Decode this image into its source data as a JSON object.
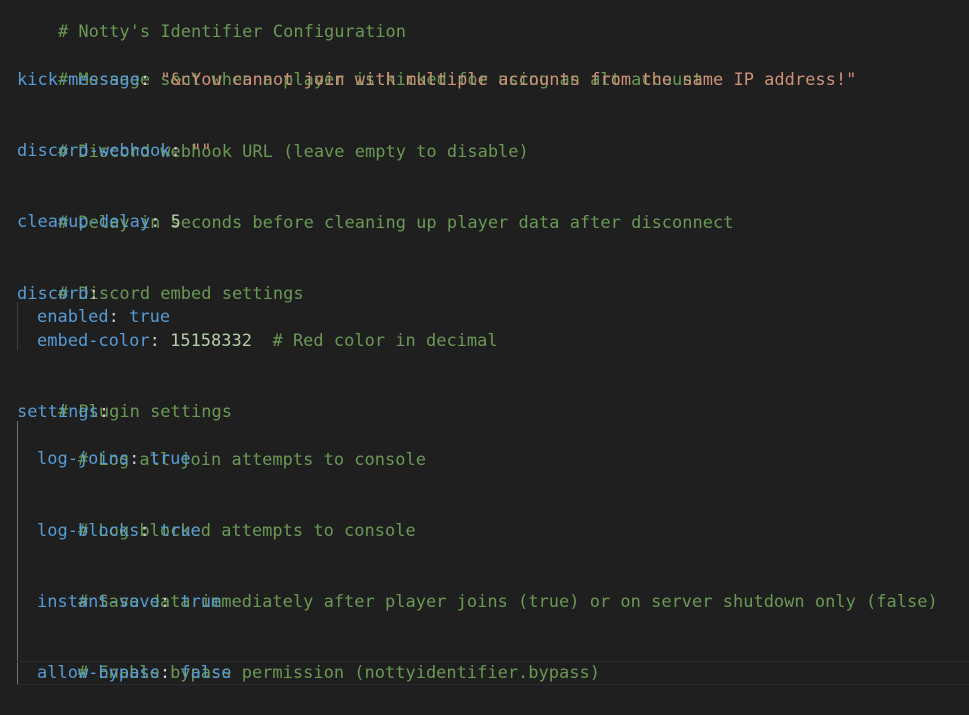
{
  "lines": {
    "l1": {
      "comment": "# Notty's Identifier Configuration"
    },
    "l3": {
      "comment": "# Message sent when a player is kicked for using an alt account"
    },
    "l4": {
      "key": "kick-message",
      "colon": ":",
      "value": "\"&cYou cannot join with multiple accounts from the same IP address!\""
    },
    "l6": {
      "comment": "# Discord webhook URL (leave empty to disable)"
    },
    "l7": {
      "key": "discord-webhook",
      "colon": ":",
      "value": "\"\""
    },
    "l9": {
      "comment": "# Delay in seconds before cleaning up player data after disconnect"
    },
    "l10": {
      "key": "cleanup-delay",
      "colon": ":",
      "value": "5"
    },
    "l12": {
      "comment": "# Discord embed settings"
    },
    "l13": {
      "key": "discord",
      "colon": ":"
    },
    "l14": {
      "key": "enabled",
      "colon": ":",
      "value": "true"
    },
    "l15": {
      "key": "embed-color",
      "colon": ":",
      "value": "15158332",
      "comment": "# Red color in decimal"
    },
    "l17": {
      "comment": "# Plugin settings"
    },
    "l18": {
      "key": "settings",
      "colon": ":"
    },
    "l19": {
      "comment": "# Log all join attempts to console"
    },
    "l20": {
      "key": "log-joins",
      "colon": ":",
      "value": "true"
    },
    "l22": {
      "comment": "# Log blocked attempts to console"
    },
    "l23": {
      "key": "log-blocks",
      "colon": ":",
      "value": "true"
    },
    "l25": {
      "comment": "# Save data immediately after player joins (true) or on server shutdown only (false)"
    },
    "l26": {
      "key": "instant-save",
      "colon": ":",
      "value": "true"
    },
    "l28": {
      "comment": "# Enable bypass permission (nottyidentifier.bypass)"
    },
    "l29": {
      "key": "allow-bypass",
      "colon": ":",
      "value": "false"
    }
  }
}
